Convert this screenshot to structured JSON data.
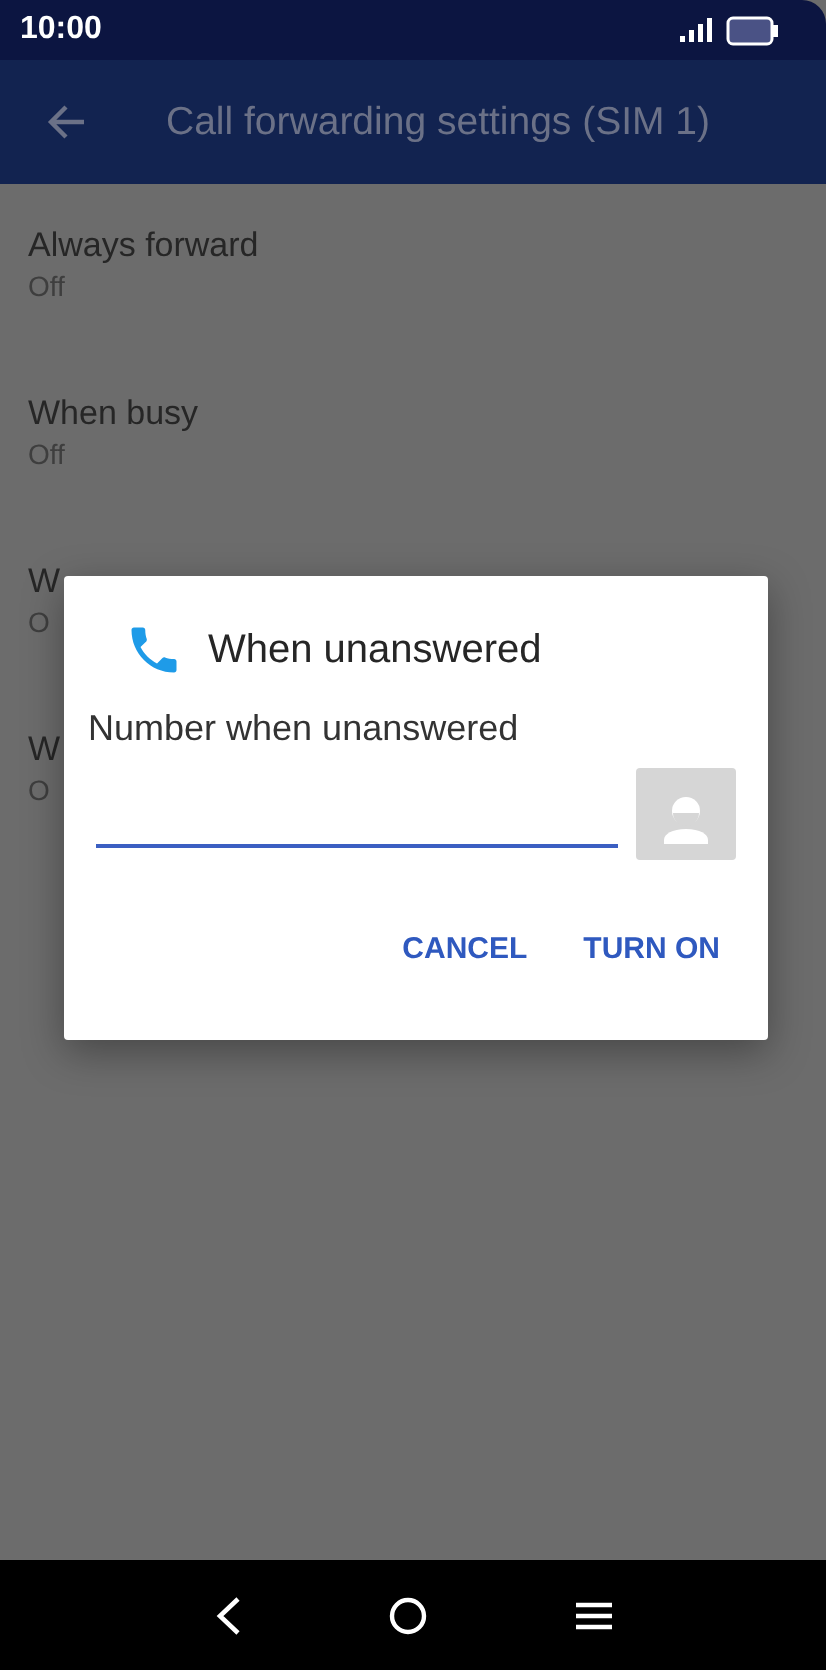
{
  "status_bar": {
    "time": "10:00"
  },
  "app_bar": {
    "title": "Call forwarding settings (SIM 1)"
  },
  "settings": [
    {
      "title": "Always forward",
      "status": "Off"
    },
    {
      "title": "When busy",
      "status": "Off"
    },
    {
      "title": "W",
      "status": "O"
    },
    {
      "title": "W",
      "status": "O"
    }
  ],
  "dialog": {
    "title": "When unanswered",
    "label": "Number when unanswered",
    "buttons": [
      "CANCEL",
      "TURN ON"
    ]
  }
}
